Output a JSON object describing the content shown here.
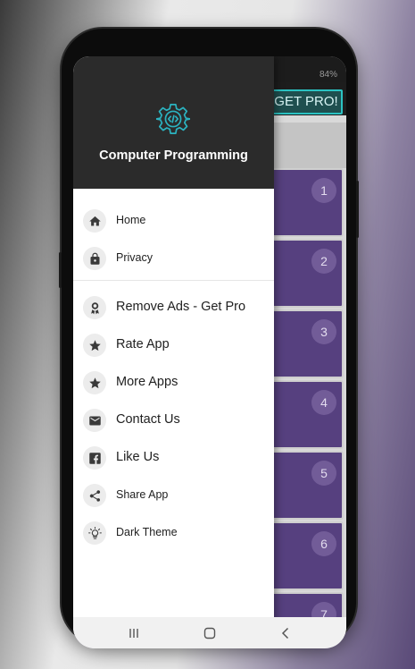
{
  "status_bar": {
    "battery": "84%"
  },
  "toolbar": {
    "get_pro_label": "GET PRO!"
  },
  "lessons": [
    "1",
    "2",
    "3",
    "4",
    "5",
    "6",
    "7"
  ],
  "drawer": {
    "title": "Computer Programming",
    "header_icon": "gear-code-icon",
    "accent_color": "#2bb3c0",
    "header_color": "#2b2b2b",
    "group1": [
      {
        "label": "Home",
        "icon": "home-icon"
      },
      {
        "label": "Privacy",
        "icon": "lock-icon"
      }
    ],
    "group2": [
      {
        "label": "Remove Ads - Get Pro",
        "icon": "award-icon"
      },
      {
        "label": "Rate App",
        "icon": "star-icon"
      },
      {
        "label": "More Apps",
        "icon": "star-icon"
      },
      {
        "label": "Contact Us",
        "icon": "email-icon"
      },
      {
        "label": "Like Us",
        "icon": "facebook-icon"
      },
      {
        "label": "Share App",
        "icon": "share-icon"
      },
      {
        "label": "Dark Theme",
        "icon": "lightbulb-icon"
      }
    ]
  },
  "nav_bar": {
    "buttons": [
      "recents-icon",
      "home-nav-icon",
      "back-icon"
    ]
  }
}
